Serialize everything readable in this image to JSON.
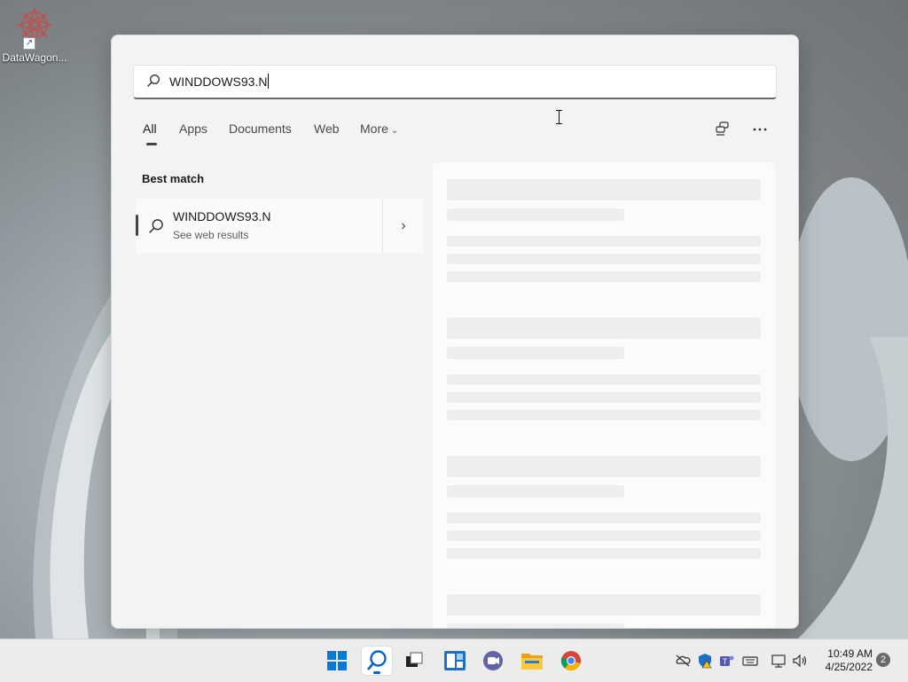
{
  "desktop": {
    "shortcut_label": "DataWagon..."
  },
  "search": {
    "query": "WINDDOWS93.N"
  },
  "tabs": [
    {
      "label": "All"
    },
    {
      "label": "Apps"
    },
    {
      "label": "Documents"
    },
    {
      "label": "Web"
    },
    {
      "label": "More"
    }
  ],
  "best_match": {
    "title": "Best match",
    "result_title": "WINDDOWS93.N",
    "result_subtitle": "See web results"
  },
  "taskbar": {
    "icons": [
      "windows-start-icon",
      "search-icon",
      "task-view-icon",
      "widgets-icon",
      "teams-chat-icon",
      "file-explorer-icon",
      "chrome-icon"
    ],
    "time": "10:49 AM",
    "date": "4/25/2022",
    "notification_count": "2"
  },
  "colors": {
    "accent": "#0a64c8"
  }
}
